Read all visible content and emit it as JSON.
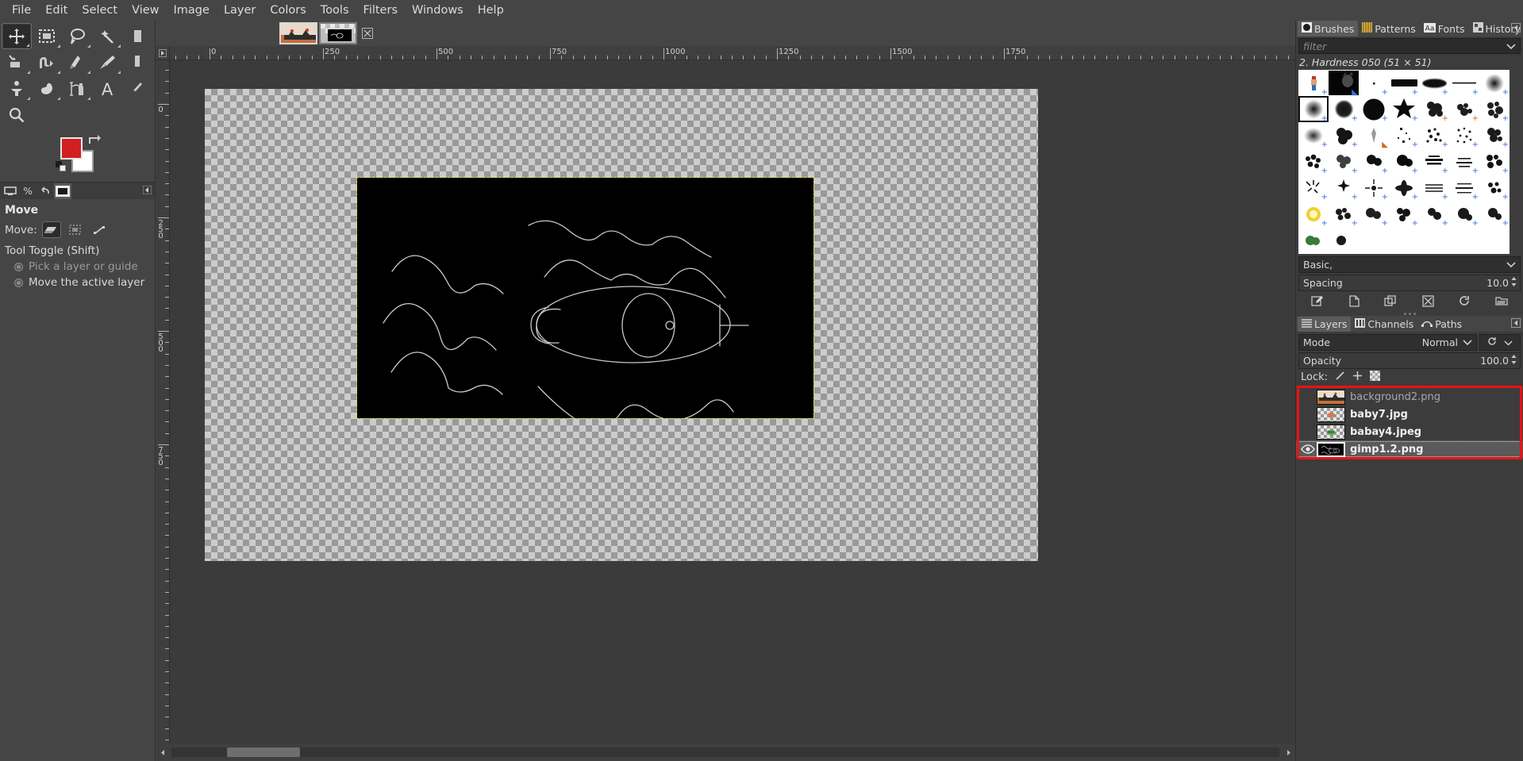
{
  "menubar": {
    "items": [
      {
        "label": "File"
      },
      {
        "label": "Edit"
      },
      {
        "label": "Select"
      },
      {
        "label": "View"
      },
      {
        "label": "Image"
      },
      {
        "label": "Layer"
      },
      {
        "label": "Colors"
      },
      {
        "label": "Tools"
      },
      {
        "label": "Filters"
      },
      {
        "label": "Windows"
      },
      {
        "label": "Help"
      }
    ]
  },
  "toolbox": {
    "tools": [
      {
        "name": "move-tool",
        "icon": "move",
        "selected": true
      },
      {
        "name": "rectangle-select-tool",
        "icon": "rect-select",
        "selected": false
      },
      {
        "name": "free-select-tool",
        "icon": "lasso",
        "selected": false
      },
      {
        "name": "fuzzy-select-tool",
        "icon": "wand",
        "selected": false
      },
      {
        "name": "bucket-fill-tool",
        "icon": "bucket-edge",
        "selected": false
      },
      {
        "name": "crop-tool",
        "icon": "crop",
        "selected": false
      },
      {
        "name": "transform-tool",
        "icon": "warp",
        "selected": false
      },
      {
        "name": "ink-tool",
        "icon": "ink",
        "selected": false
      },
      {
        "name": "paintbrush-tool",
        "icon": "brush",
        "selected": false
      },
      {
        "name": "eraser-tool",
        "icon": "eraser",
        "selected": false
      },
      {
        "name": "clone-tool",
        "icon": "clone",
        "selected": false
      },
      {
        "name": "smudge-tool",
        "icon": "smudge",
        "selected": false
      },
      {
        "name": "airbrush-tool",
        "icon": "airbrush",
        "selected": false
      },
      {
        "name": "text-tool",
        "icon": "text-A",
        "selected": false
      },
      {
        "name": "color-picker-tool",
        "icon": "eyedropper",
        "selected": false
      },
      {
        "name": "zoom-tool",
        "icon": "magnifier",
        "selected": false
      }
    ],
    "foreground_color": "#d21f1f",
    "background_color": "#ffffff"
  },
  "tool_options": {
    "tabs": [
      "device-status-icon",
      "tool-options-icon",
      "undo-history-icon",
      "images-icon"
    ],
    "active_tab_index": 3,
    "title": "Move",
    "move_label": "Move:",
    "move_modes": [
      {
        "name": "move-layer-mode",
        "selected": true
      },
      {
        "name": "move-selection-mode",
        "selected": false
      },
      {
        "name": "move-path-mode",
        "selected": false
      }
    ],
    "toggle_section": "Tool Toggle  (Shift)",
    "radios": [
      {
        "label": "Pick a layer or guide",
        "selected": true,
        "dim": true
      },
      {
        "label": "Move the active layer",
        "selected": false,
        "dim": false
      }
    ]
  },
  "image_window": {
    "thumbnails": [
      {
        "name": "image-thumb-1",
        "selected": true
      },
      {
        "name": "image-thumb-2",
        "selected": false
      }
    ],
    "close_label": "☒",
    "h_ruler_labels": [
      "0",
      "250",
      "500",
      "750",
      "1000",
      "1250",
      "1500",
      "1750"
    ],
    "v_ruler_labels": [
      "0",
      "250",
      "500",
      "750"
    ]
  },
  "right_dock": {
    "top_tabs": [
      {
        "label": "Brushes",
        "icon": "brushes-icon",
        "active": true
      },
      {
        "label": "Patterns",
        "icon": "patterns-icon",
        "active": false
      },
      {
        "label": "Fonts",
        "icon": "fonts-icon",
        "active": false
      },
      {
        "label": "History",
        "icon": "history-icon",
        "active": false
      }
    ],
    "filter_placeholder": "filter",
    "brush_name": "2. Hardness 050 (51 × 51)",
    "tag_value": "Basic,",
    "spacing_label": "Spacing",
    "spacing_value": "10.0",
    "brush_actions": [
      "edit-brush-icon",
      "new-brush-icon",
      "duplicate-brush-icon",
      "delete-brush-icon",
      "refresh-brushes-icon",
      "open-brush-folder-icon"
    ]
  },
  "layers_dock": {
    "tabs": [
      {
        "label": "Layers",
        "icon": "layers-icon",
        "active": true
      },
      {
        "label": "Channels",
        "icon": "channels-icon",
        "active": false
      },
      {
        "label": "Paths",
        "icon": "paths-icon",
        "active": false
      }
    ],
    "mode_label": "Mode",
    "mode_value": "Normal",
    "opacity_label": "Opacity",
    "opacity_value": "100.0",
    "lock_label": "Lock:",
    "lock_icons": [
      "lock-pixels-icon",
      "lock-position-icon",
      "lock-alpha-icon"
    ],
    "highlight_color": "#ee1111",
    "layers": [
      {
        "name": "background2.png",
        "visible": false,
        "selected": false,
        "bold": false
      },
      {
        "name": "baby7.jpg",
        "visible": false,
        "selected": false,
        "bold": true
      },
      {
        "name": "babay4.jpeg",
        "visible": false,
        "selected": false,
        "bold": true
      },
      {
        "name": "gimp1.2.png",
        "visible": true,
        "selected": true,
        "bold": true
      }
    ]
  }
}
